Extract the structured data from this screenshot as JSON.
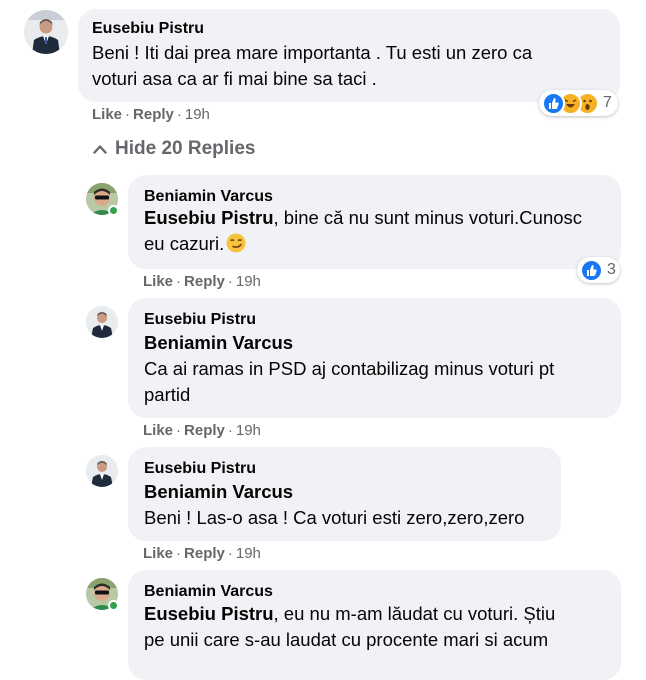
{
  "comments": [
    {
      "author": "Eusebiu Pistru",
      "mention": "",
      "text_lines": [
        "Beni ! Iti dai prea mare importanta . Tu esti un zero ca",
        "voturi asa ca ar fi mai bine sa taci ."
      ],
      "like_label": "Like",
      "reply_label": "Reply",
      "time": "19h",
      "reactions": {
        "icons": [
          "like-icon",
          "haha-icon",
          "wow-icon"
        ],
        "count": "7"
      }
    },
    {
      "author": "Beniamin Varcus",
      "mention": "Eusebiu Pistru",
      "text_lines": [
        ", bine că nu sunt minus voturi.Cunosc",
        "eu cazuri."
      ],
      "emoji": "smirk-emoji-icon",
      "like_label": "Like",
      "reply_label": "Reply",
      "time": "19h",
      "reactions": {
        "icons": [
          "like-icon"
        ],
        "count": "3"
      }
    },
    {
      "author": "Eusebiu Pistru",
      "mention": "Beniamin Varcus",
      "text_lines": [
        "Ca ai ramas in PSD aj contabilizag minus voturi pt",
        "partid"
      ],
      "like_label": "Like",
      "reply_label": "Reply",
      "time": "19h"
    },
    {
      "author": "Eusebiu Pistru",
      "mention": "Beniamin Varcus",
      "text_lines": [
        "Beni ! Las-o asa ! Ca voturi esti zero,zero,zero"
      ],
      "like_label": "Like",
      "reply_label": "Reply",
      "time": "19h"
    },
    {
      "author": "Beniamin Varcus",
      "mention": "Eusebiu Pistru",
      "text_lines": [
        ", eu nu m-am lăudat cu voturi. Știu",
        "pe unii care s-au laudat cu procente mari si acum"
      ]
    }
  ],
  "hide_replies_label": "Hide 20 Replies",
  "colors": {
    "bubble": "#f0f2f5",
    "meta_gray": "#65676b",
    "like_blue": "#1877f2",
    "online_green": "#31a24c"
  }
}
